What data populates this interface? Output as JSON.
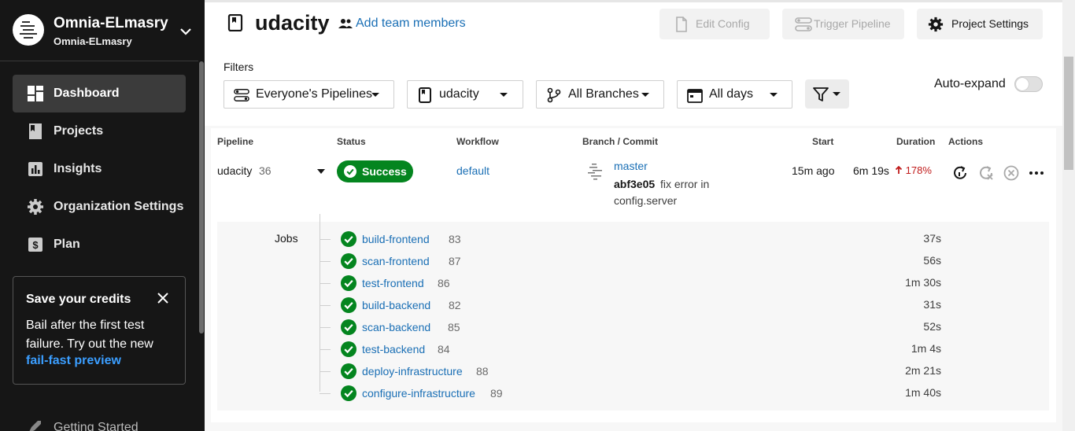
{
  "sidebar": {
    "org_name": "Omnia-ELmasry",
    "org_login": "Omnia-ELmasry",
    "items": [
      {
        "label": "Dashboard",
        "icon": "dashboard-icon",
        "active": true
      },
      {
        "label": "Projects",
        "icon": "projects-icon",
        "active": false
      },
      {
        "label": "Insights",
        "icon": "insights-icon",
        "active": false
      },
      {
        "label": "Organization Settings",
        "icon": "gear-icon",
        "active": false
      },
      {
        "label": "Plan",
        "icon": "dollar-icon",
        "active": false
      }
    ],
    "credits": {
      "title": "Save your credits",
      "body": "Bail after the first test failure. Try out the new",
      "link": "fail-fast preview"
    },
    "getting_started": "Getting Started"
  },
  "header": {
    "project_title": "udacity",
    "add_team": "Add team members",
    "edit_config": "Edit Config",
    "trigger_pipeline": "Trigger Pipeline",
    "project_settings": "Project Settings"
  },
  "filters": {
    "label": "Filters",
    "pipelines": "Everyone's Pipelines",
    "project": "udacity",
    "branches": "All Branches",
    "days": "All days",
    "auto_expand": "Auto-expand",
    "auto_expand_on": false
  },
  "table": {
    "columns": {
      "pipeline": "Pipeline",
      "status": "Status",
      "workflow": "Workflow",
      "branch_commit": "Branch / Commit",
      "start": "Start",
      "duration": "Duration",
      "actions": "Actions"
    },
    "row": {
      "pipeline": "udacity",
      "number": "36",
      "status": "Success",
      "workflow": "default",
      "branch": "master",
      "sha": "abf3e05",
      "message_line1": "fix error in",
      "message_line2": "config.server",
      "start": "15m ago",
      "duration": "6m 19s",
      "duration_delta": "178%"
    },
    "jobs_label": "Jobs",
    "jobs": [
      {
        "name": "build-frontend",
        "number": "83",
        "duration": "37s"
      },
      {
        "name": "scan-frontend",
        "number": "87",
        "duration": "56s"
      },
      {
        "name": "test-frontend",
        "number": "86",
        "duration": "1m 30s"
      },
      {
        "name": "build-backend",
        "number": "82",
        "duration": "31s"
      },
      {
        "name": "scan-backend",
        "number": "85",
        "duration": "52s"
      },
      {
        "name": "test-backend",
        "number": "84",
        "duration": "1m 4s"
      },
      {
        "name": "deploy-infrastructure",
        "number": "88",
        "duration": "2m 21s"
      },
      {
        "name": "configure-infrastructure",
        "number": "89",
        "duration": "1m 40s"
      }
    ]
  },
  "colors": {
    "success": "#04851f",
    "link": "#1a6fb5",
    "sidebar_bg": "#161616",
    "delta_up": "#c01b1b"
  }
}
